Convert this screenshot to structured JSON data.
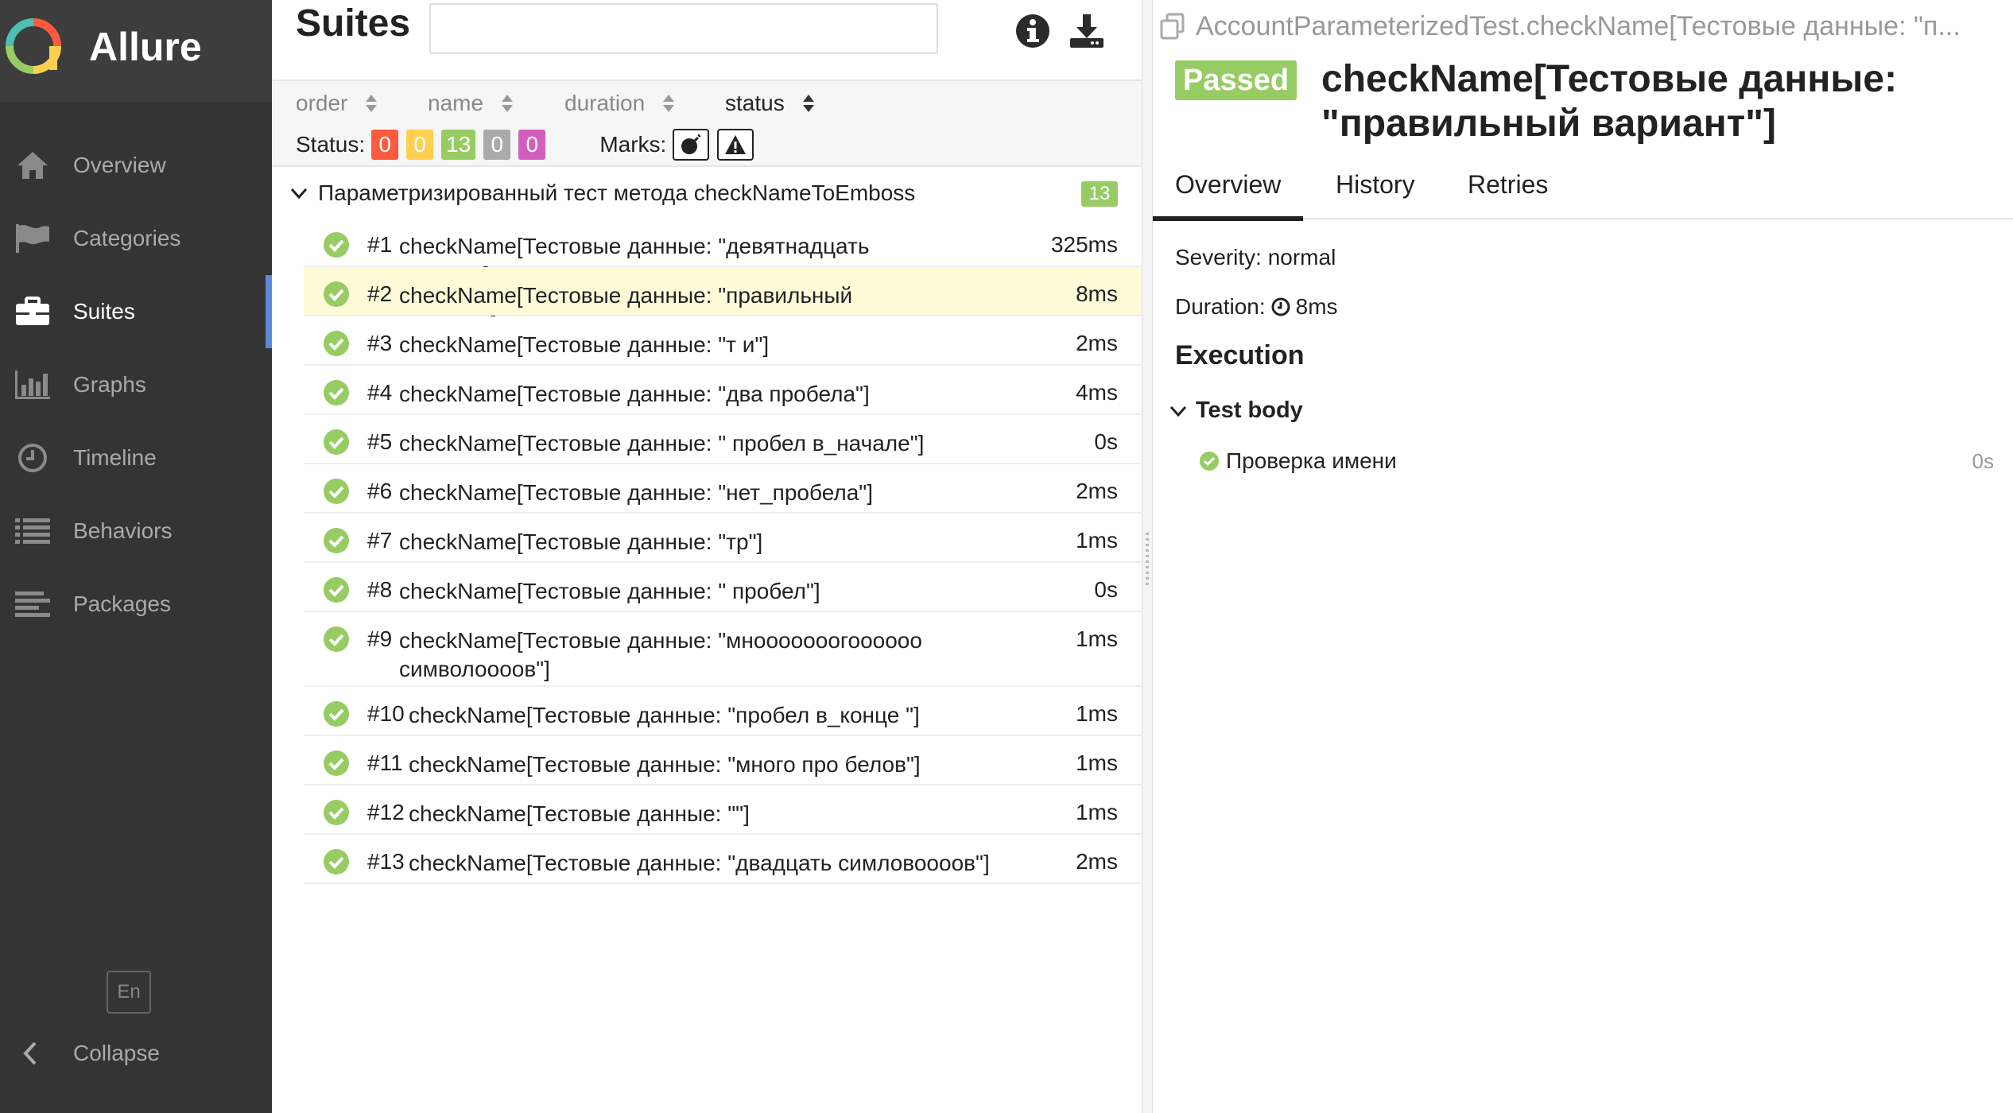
{
  "app": {
    "name": "Allure"
  },
  "sidebar": {
    "items": [
      {
        "label": "Overview",
        "icon": "home-icon",
        "active": false
      },
      {
        "label": "Categories",
        "icon": "flag-icon",
        "active": false
      },
      {
        "label": "Suites",
        "icon": "briefcase-icon",
        "active": true
      },
      {
        "label": "Graphs",
        "icon": "bar-chart-icon",
        "active": false
      },
      {
        "label": "Timeline",
        "icon": "clock-icon",
        "active": false
      },
      {
        "label": "Behaviors",
        "icon": "list-icon",
        "active": false
      },
      {
        "label": "Packages",
        "icon": "align-left-icon",
        "active": false
      }
    ],
    "language": "En",
    "collapse_label": "Collapse"
  },
  "suites": {
    "title": "Suites",
    "search": {
      "value": "",
      "placeholder": ""
    },
    "sort": {
      "order": "order",
      "name": "name",
      "duration": "duration",
      "status": "status"
    },
    "status_label": "Status:",
    "status_counts": [
      {
        "name": "failed",
        "value": "0",
        "color": "#fd5a3e"
      },
      {
        "name": "broken",
        "value": "0",
        "color": "#ffd050"
      },
      {
        "name": "passed",
        "value": "13",
        "color": "#97cc64"
      },
      {
        "name": "skipped",
        "value": "0",
        "color": "#aaaaaa"
      },
      {
        "name": "unknown",
        "value": "0",
        "color": "#d35ebe"
      }
    ],
    "marks_label": "Marks:",
    "group": {
      "name": "Параметризированный тест метода checkNameToEmboss",
      "count": "13"
    },
    "rows": [
      {
        "num": "#1",
        "name": "checkName[Тестовые данные: \"девятнадцать симлов\"]",
        "duration": "325ms"
      },
      {
        "num": "#2",
        "name": "checkName[Тестовые данные: \"правильный вариант\"]",
        "duration": "8ms"
      },
      {
        "num": "#3",
        "name": "checkName[Тестовые данные: \"т и\"]",
        "duration": "2ms"
      },
      {
        "num": "#4",
        "name": "checkName[Тестовые данные: \"два пробела\"]",
        "duration": "4ms"
      },
      {
        "num": "#5",
        "name": "checkName[Тестовые данные: \" пробел в_начале\"]",
        "duration": "0s"
      },
      {
        "num": "#6",
        "name": "checkName[Тестовые данные: \"нет_пробела\"]",
        "duration": "2ms"
      },
      {
        "num": "#7",
        "name": "checkName[Тестовые данные: \"тр\"]",
        "duration": "1ms"
      },
      {
        "num": "#8",
        "name": "checkName[Тестовые данные: \" пробел\"]",
        "duration": "0s"
      },
      {
        "num": "#9",
        "name": "checkName[Тестовые данные: \"мнооооооогоооооо символоооов\"]",
        "duration": "1ms"
      },
      {
        "num": "#10",
        "name": "checkName[Тестовые данные: \"пробел в_конце \"]",
        "duration": "1ms"
      },
      {
        "num": "#11",
        "name": "checkName[Тестовые данные: \"много про белов\"]",
        "duration": "1ms"
      },
      {
        "num": "#12",
        "name": "checkName[Тестовые данные: \"\"]",
        "duration": "1ms"
      },
      {
        "num": "#13",
        "name": "checkName[Тестовые данные: \"двадцать симловоооов\"]",
        "duration": "2ms"
      }
    ]
  },
  "details": {
    "breadcrumb": "AccountParameterizedTest.checkName[Тестовые данные: \"п...",
    "status_badge": "Passed",
    "title": "checkName[Тестовые данные: \"правильный вариант\"]",
    "tabs": [
      "Overview",
      "History",
      "Retries"
    ],
    "severity": "Severity: normal",
    "duration_label": "Duration:",
    "duration_value": "8ms",
    "execution_title": "Execution",
    "test_body_label": "Test body",
    "steps": [
      {
        "name": "Проверка имени",
        "duration": "0s"
      }
    ]
  },
  "colors": {
    "sidebar_bg": "#343434",
    "passed": "#97cc64",
    "accent": "#5a8bd6",
    "selected_row": "#fffbd9"
  }
}
